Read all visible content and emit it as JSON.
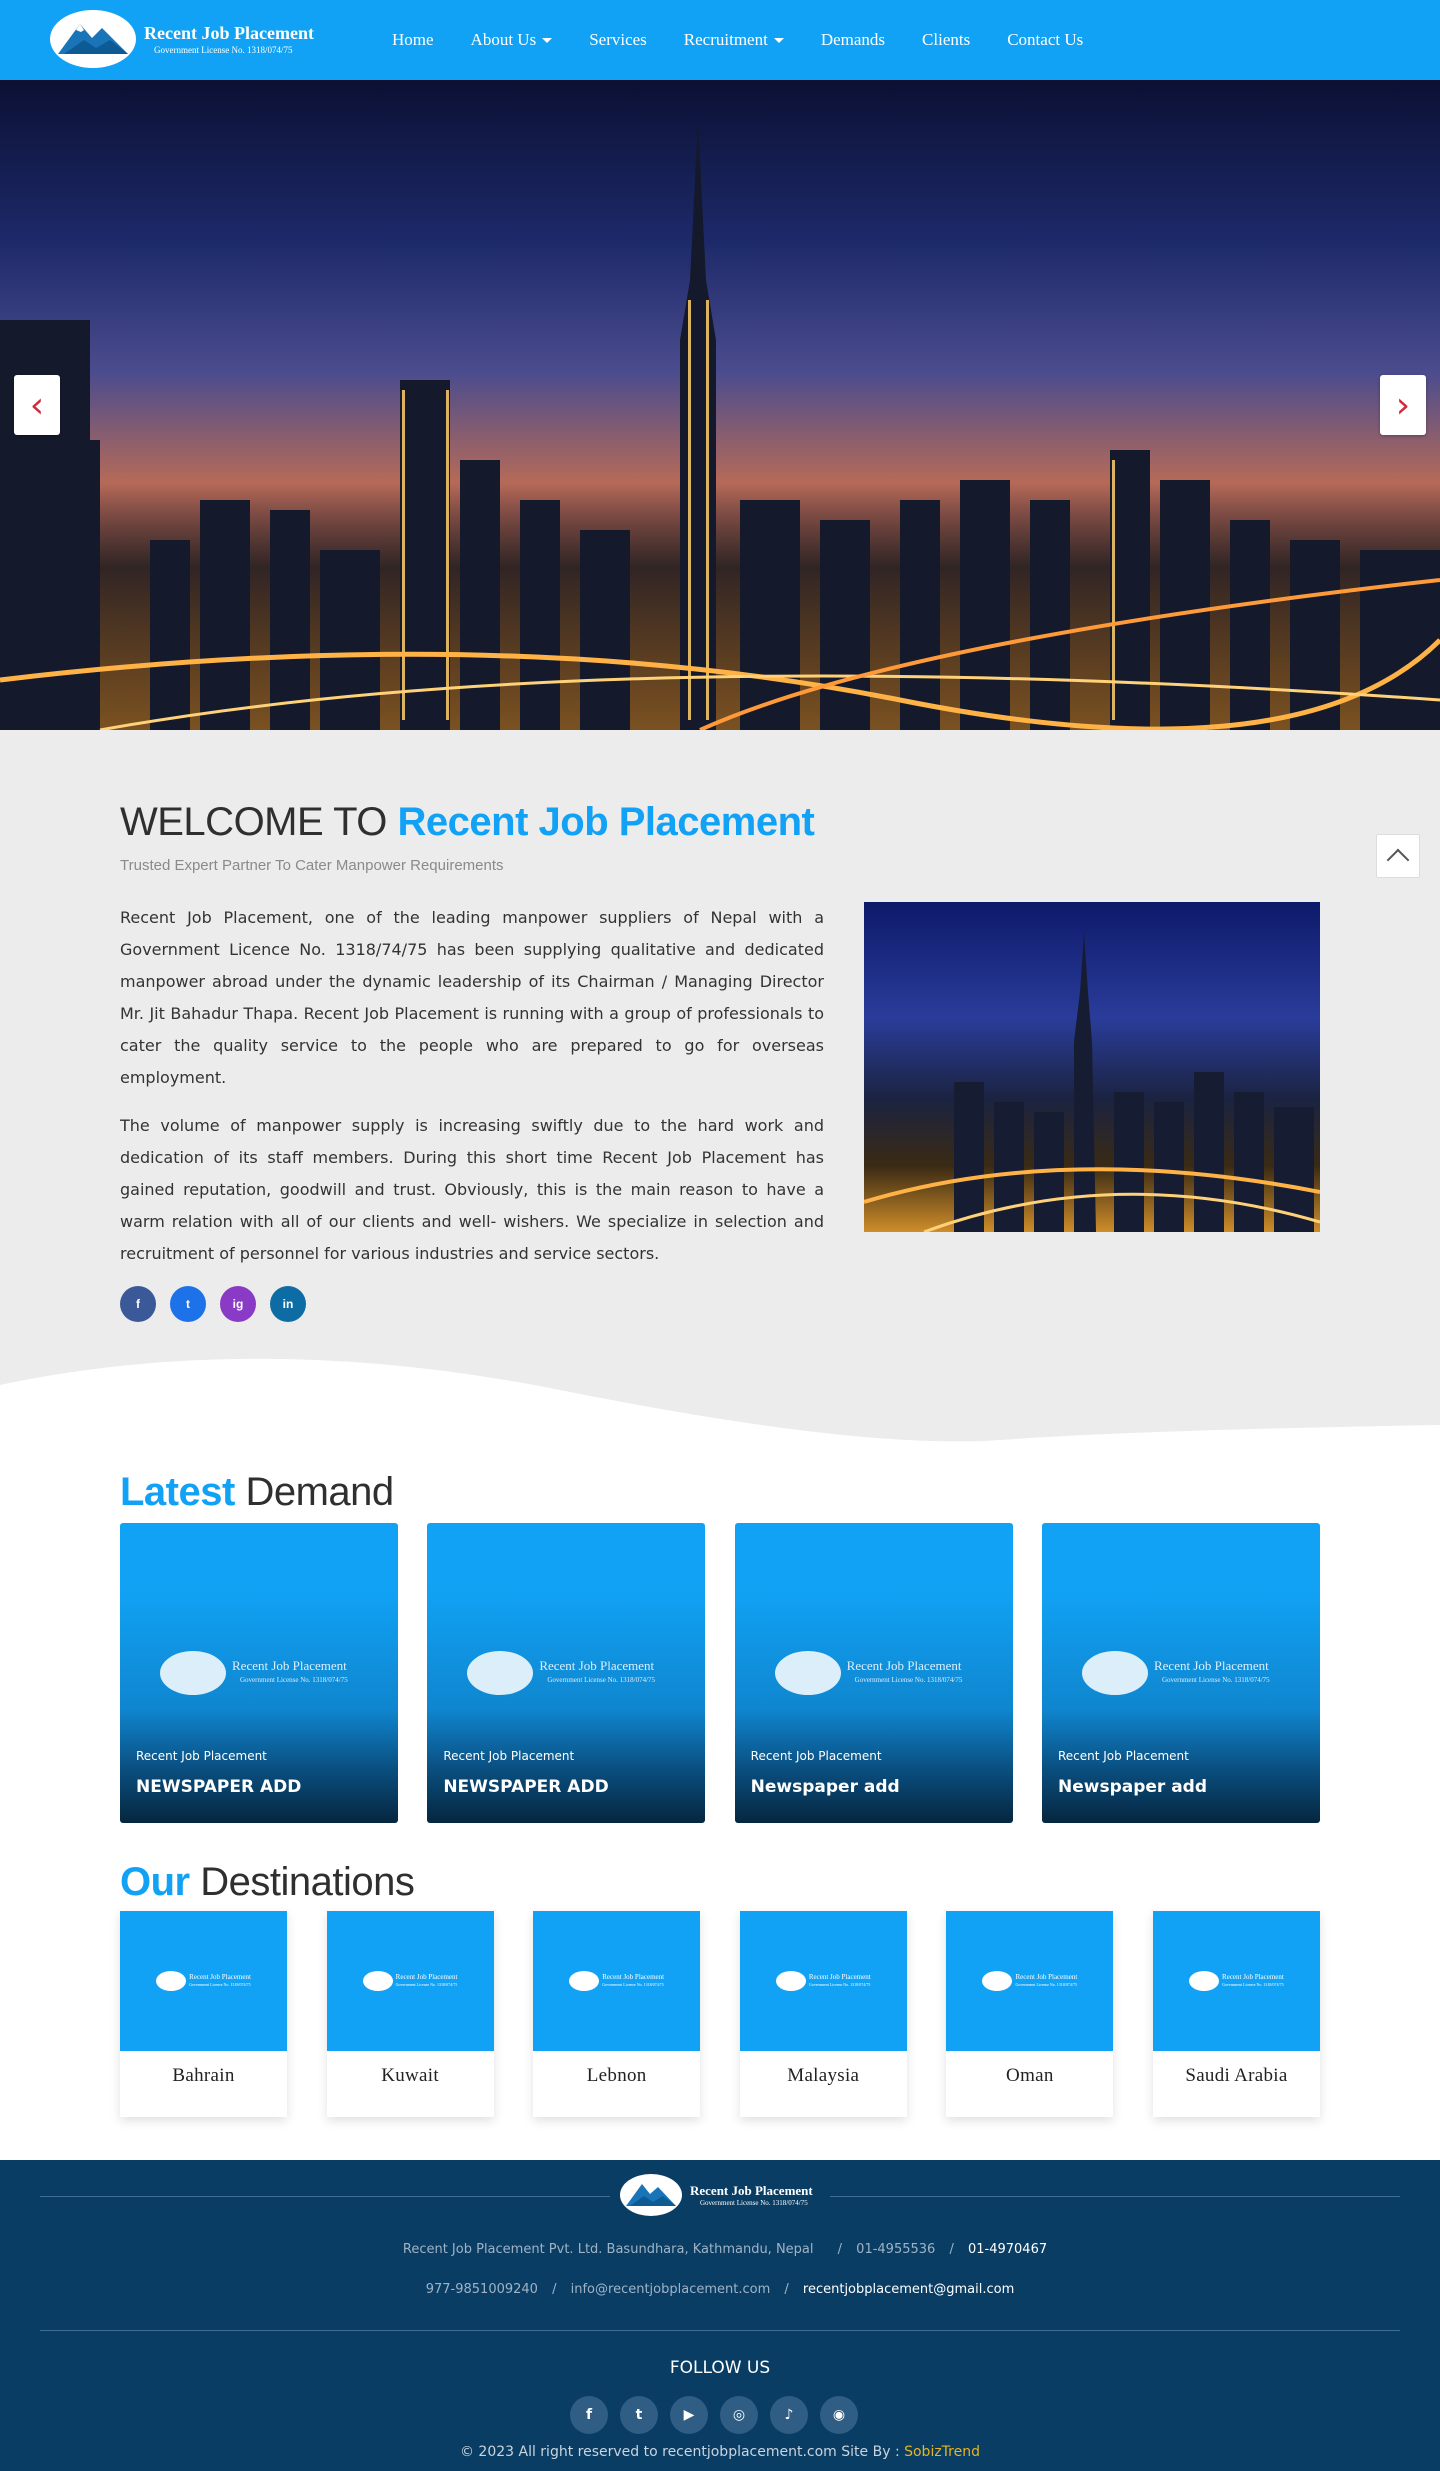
{
  "brand": {
    "title": "Recent Job Placement",
    "license": "Government License No. 1318/074/75"
  },
  "nav": {
    "items": [
      {
        "label": "Home",
        "dropdown": false
      },
      {
        "label": "About Us",
        "dropdown": true
      },
      {
        "label": "Services",
        "dropdown": false
      },
      {
        "label": "Recruitment",
        "dropdown": true
      },
      {
        "label": "Demands",
        "dropdown": false
      },
      {
        "label": "Clients",
        "dropdown": false
      },
      {
        "label": "Contact Us",
        "dropdown": false
      }
    ]
  },
  "welcome": {
    "title_prefix": "WELCOME TO",
    "title_accent": "Recent Job Placement",
    "tagline": "Trusted Expert Partner To Cater Manpower Requirements",
    "paragraphs": [
      "Recent Job Placement, one of the leading manpower suppliers of Nepal with a Government Licence No. 1318/74/75 has been supplying qualitative and dedicated manpower abroad under the dynamic leadership of its Chairman / Managing Director Mr. Jit Bahadur Thapa. Recent Job Placement is running with a group of professionals to cater the quality service to the people who are prepared to go for overseas employment.",
      "The volume of manpower supply is increasing swiftly due to the hard work and dedication of its staff members. During this short time Recent Job Placement has gained reputation, goodwill and trust. Obviously, this is the main reason to have a warm relation with all of our clients and well- wishers. We specialize in selection and recruitment of personnel for various industries and service sectors."
    ],
    "socials": [
      "f",
      "t",
      "ig",
      "in"
    ]
  },
  "demands": {
    "title_accent": "Latest",
    "title_rest": "Demand",
    "cards": [
      {
        "company": "Recent Job Placement",
        "title": "NEWSPAPER ADD"
      },
      {
        "company": "Recent Job Placement",
        "title": "NEWSPAPER ADD"
      },
      {
        "company": "Recent Job Placement",
        "title": "Newspaper add"
      },
      {
        "company": "Recent Job Placement",
        "title": "Newspaper add"
      }
    ]
  },
  "destinations": {
    "title_accent": "Our",
    "title_rest": "Destinations",
    "items": [
      "Bahrain",
      "Kuwait",
      "Lebnon",
      "Malaysia",
      "Oman",
      "Saudi Arabia"
    ]
  },
  "footer": {
    "address": "Recent Job Placement Pvt. Ltd. Basundhara, Kathmandu, Nepal",
    "phone1": "01-4955536",
    "phone2": "01-4970467",
    "mobile": "977-9851009240",
    "email1": "info@recentjobplacement.com",
    "email2": "recentjobplacement@gmail.com",
    "separator": "/",
    "follow_label": "FOLLOW US",
    "social_icons": [
      "f",
      "t",
      "▶",
      "◎",
      "♪",
      "◉"
    ],
    "copyright_text": "© 2023 All right reserved to recentjobplacement.com Site By :",
    "site_by": "SobizTrend"
  },
  "colors": {
    "brand_blue": "#11a2f5",
    "footer_navy": "#0a3d64",
    "accent_yellow": "#e6b422"
  }
}
